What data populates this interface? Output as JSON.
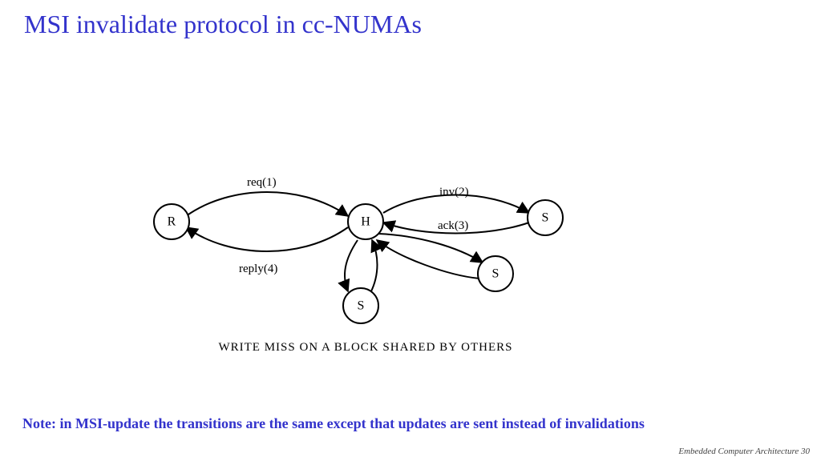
{
  "title": "MSI invalidate protocol in cc-NUMAs",
  "note": "Note: in MSI-update the transitions are the same except that updates are sent instead of invalidations",
  "footer": "Embedded Computer Architecture  30",
  "diagram": {
    "caption": "WRITE MISS ON A BLOCK SHARED BY OTHERS",
    "nodes": {
      "R": "R",
      "H": "H",
      "S1": "S",
      "S2": "S",
      "S3": "S"
    },
    "edges": {
      "req": "req(1)",
      "reply": "reply(4)",
      "inv": "inv(2)",
      "ack": "ack(3)"
    }
  }
}
